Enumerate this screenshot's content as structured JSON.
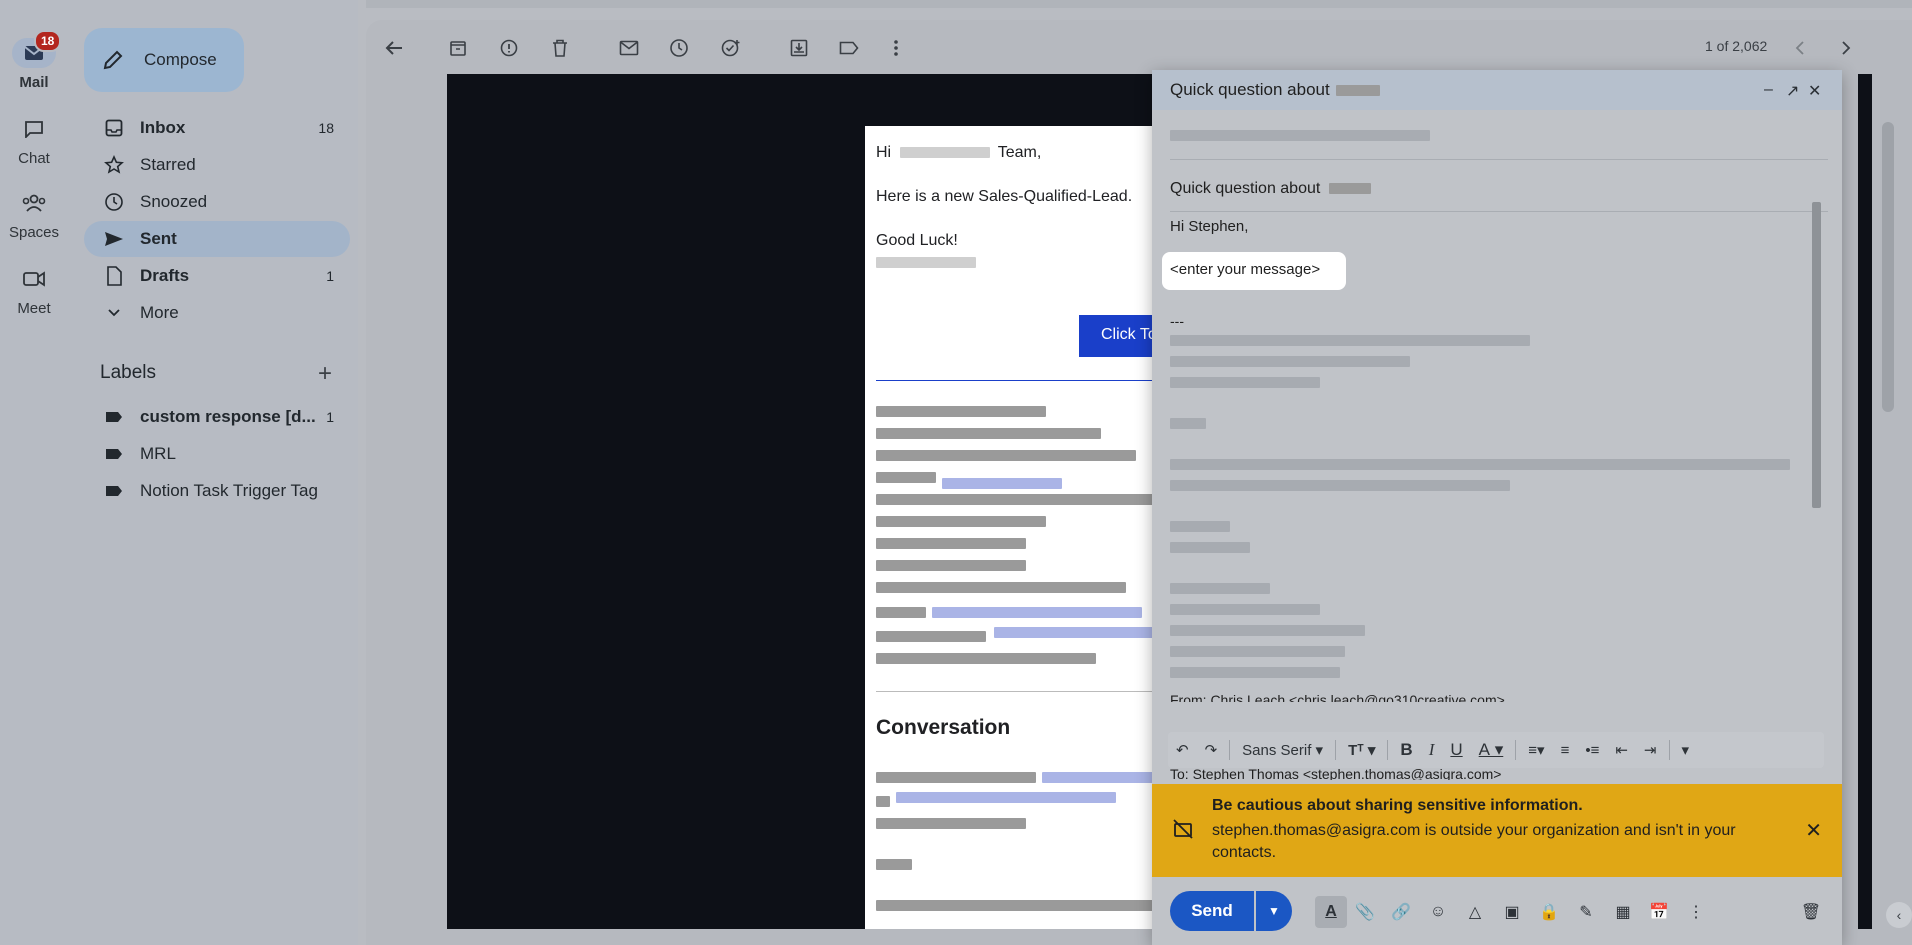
{
  "rail": {
    "mail": {
      "label": "Mail",
      "badge": "18"
    },
    "chat": {
      "label": "Chat"
    },
    "spaces": {
      "label": "Spaces"
    },
    "meet": {
      "label": "Meet"
    }
  },
  "sidebar": {
    "compose_label": "Compose",
    "items": [
      {
        "label": "Inbox",
        "count": "18",
        "icon": "inbox-icon"
      },
      {
        "label": "Starred",
        "count": "",
        "icon": "star-icon"
      },
      {
        "label": "Snoozed",
        "count": "",
        "icon": "clock-icon"
      },
      {
        "label": "Sent",
        "count": "",
        "icon": "send-icon"
      },
      {
        "label": "Drafts",
        "count": "1",
        "icon": "draft-icon"
      },
      {
        "label": "More",
        "count": "",
        "icon": "chevron-down-icon"
      }
    ],
    "labels_heading": "Labels",
    "labels": [
      {
        "label": "custom response [d...",
        "count": "1"
      },
      {
        "label": "MRL",
        "count": ""
      },
      {
        "label": "Notion Task Trigger Tag",
        "count": ""
      }
    ]
  },
  "toolbar": {
    "page_info": "1 of 2,062"
  },
  "email": {
    "greeting_prefix": "Hi",
    "greeting_suffix": "Team,",
    "line1": "Here is a new Sales-Qualified-Lead.",
    "line2": "Good Luck!",
    "button_label": "Click To",
    "conversation_heading": "Conversation"
  },
  "compose_window": {
    "title": "Quick question about",
    "subject": "Quick question about",
    "greeting": "Hi Stephen,",
    "placeholder_message": "<enter your message>",
    "separator": "---",
    "from_line": "From: Chris Leach <chris.leach@go310creative.com>",
    "to_line": "To: Stephen Thomas <stephen.thomas@asigra.com>",
    "font_name": "Sans Serif",
    "warning_title": "Be cautious about sharing sensitive information.",
    "warning_body": "stephen.thomas@asigra.com is outside your organization and isn't in your contacts.",
    "send_label": "Send"
  },
  "colors": {
    "accent": "#1b57c4",
    "warning": "#e0a715",
    "badge": "#b3261e"
  }
}
